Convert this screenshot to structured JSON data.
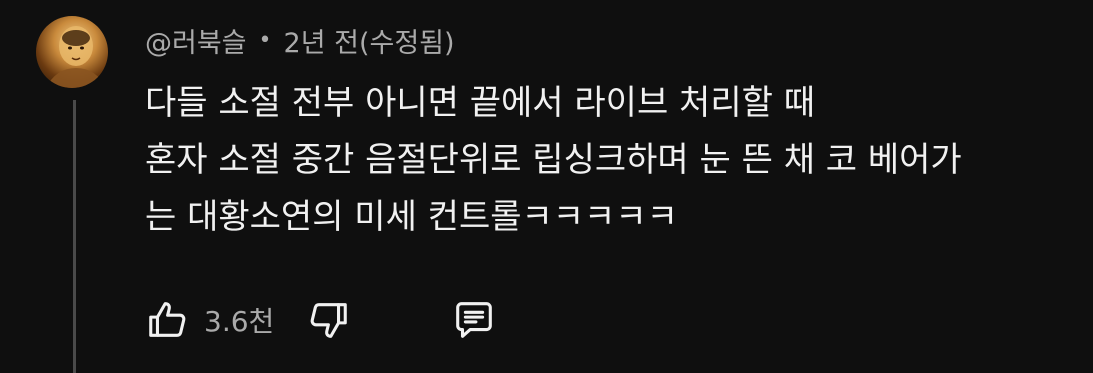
{
  "comment": {
    "author": "@러북슬",
    "separator": "•",
    "time": "2년 전(수정됨)",
    "lines": [
      "다들 소절 전부 아니면 끝에서 라이브 처리할 때",
      "혼자 소절 중간 음절단위로 립싱크하며 눈 뜬 채 코 베어가",
      "는 대황소연의 미세 컨트롤ㅋㅋㅋㅋㅋ"
    ]
  },
  "actions": {
    "like_icon": "thumbs-up-icon",
    "like_count": "3.6천",
    "dislike_icon": "thumbs-down-icon",
    "reply_icon": "comment-icon"
  },
  "colors": {
    "background": "#0f0f0f",
    "primary_text": "#f1f1f1",
    "secondary_text": "#aaaaaa",
    "thread_line": "#4a4a4a"
  }
}
